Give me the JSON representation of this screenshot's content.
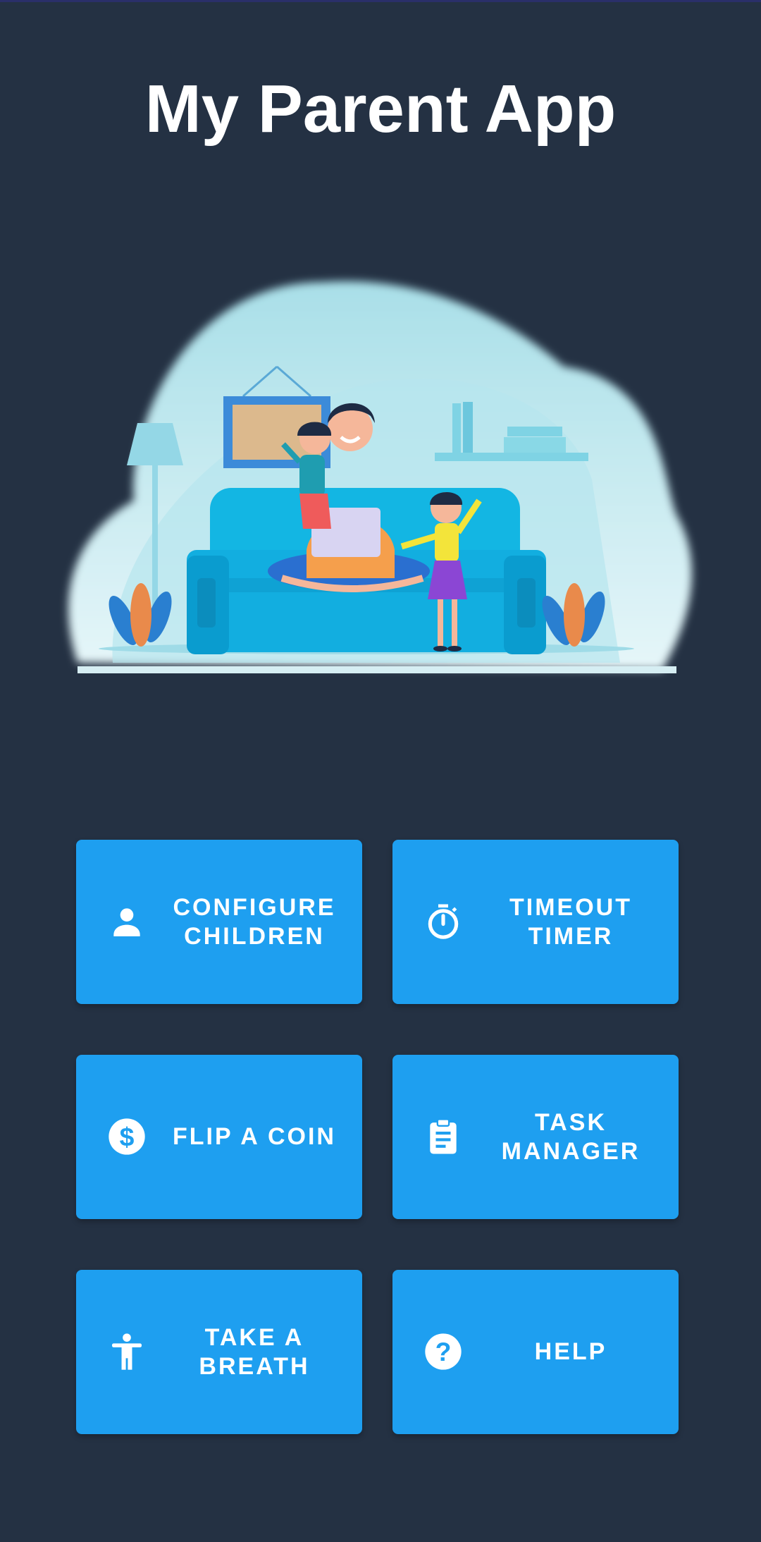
{
  "app": {
    "title": "My Parent App"
  },
  "buttons": [
    {
      "label": "CONFIGURE\nCHILDREN",
      "icon": "person-icon"
    },
    {
      "label": "TIMEOUT\nTIMER",
      "icon": "stopwatch-icon"
    },
    {
      "label": "FLIP A COIN",
      "icon": "dollar-coin-icon"
    },
    {
      "label": "TASK\nMANAGER",
      "icon": "clipboard-icon"
    },
    {
      "label": "TAKE A\nBREATH",
      "icon": "accessibility-person-icon"
    },
    {
      "label": "HELP",
      "icon": "help-circle-icon"
    }
  ],
  "colors": {
    "background": "#243143",
    "button": "#1e9ff0",
    "text": "#ffffff"
  }
}
